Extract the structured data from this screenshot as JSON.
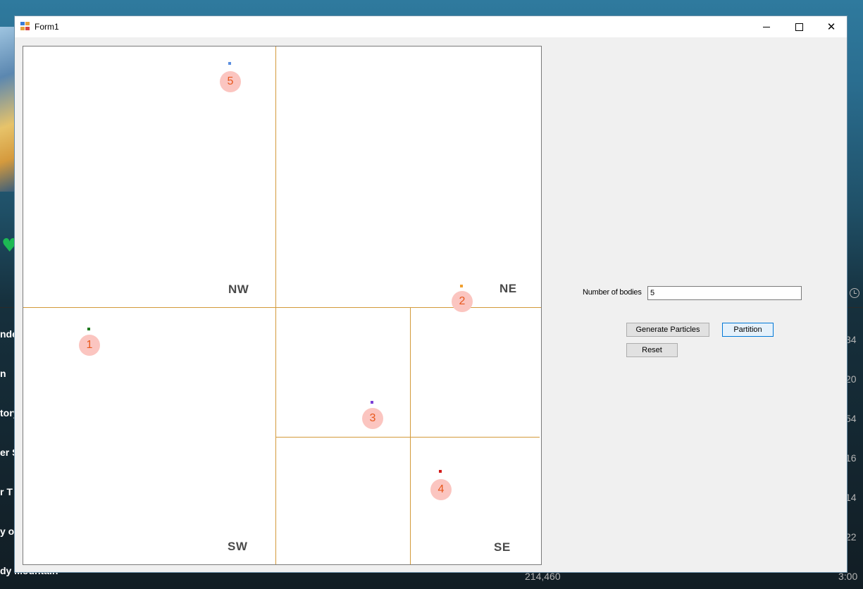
{
  "window": {
    "title": "Form1"
  },
  "background": {
    "left_fragments": [
      "nde",
      "n",
      "tory",
      "er S",
      "r T",
      "y of",
      "dy Mountain"
    ],
    "right_fragments": [
      "34",
      "20",
      "54",
      "16",
      "14",
      "22",
      "3:00"
    ],
    "play_count": "214,460"
  },
  "quadtree": {
    "quadrant_labels": {
      "nw": "NW",
      "ne": "NE",
      "sw": "SW",
      "se": "SE"
    },
    "bodies": [
      {
        "id": "1",
        "color": "#1f7a1f"
      },
      {
        "id": "2",
        "color": "#f0a030"
      },
      {
        "id": "3",
        "color": "#7b3fd6"
      },
      {
        "id": "4",
        "color": "#d21a1a"
      },
      {
        "id": "5",
        "color": "#5b8fe0"
      }
    ]
  },
  "controls": {
    "bodies_label": "Number of bodies",
    "bodies_value": "5",
    "generate_label": "Generate Particles",
    "partition_label": "Partition",
    "reset_label": "Reset"
  }
}
